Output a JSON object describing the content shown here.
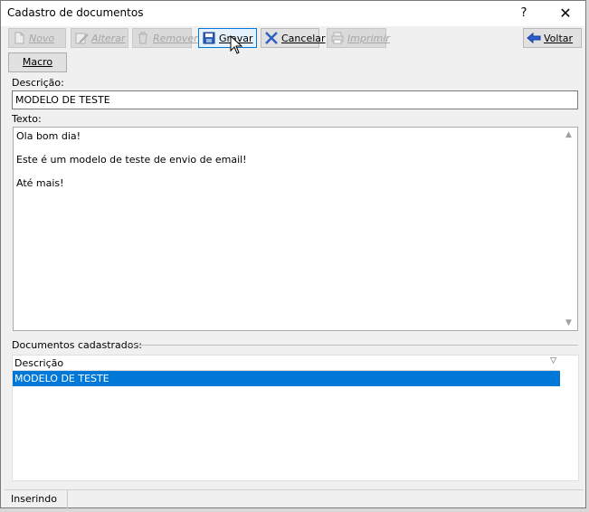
{
  "window": {
    "title": "Cadastro de documentos",
    "help_label": "?",
    "close_label": "✕"
  },
  "toolbar": {
    "novo": {
      "label": "Novo",
      "icon": "new-document-icon",
      "enabled": false
    },
    "alterar": {
      "label": "Alterar",
      "icon": "edit-icon",
      "enabled": false
    },
    "remover": {
      "label": "Remover",
      "icon": "trash-icon",
      "enabled": false
    },
    "gravar": {
      "label": "Gravar",
      "icon": "save-icon",
      "enabled": true
    },
    "cancelar": {
      "label": "Cancelar",
      "icon": "cancel-x-icon",
      "enabled": true
    },
    "imprimir": {
      "label": "Imprimir",
      "icon": "printer-icon",
      "enabled": false
    },
    "voltar": {
      "label": "Voltar",
      "icon": "back-arrow-icon",
      "enabled": true
    }
  },
  "macro": {
    "label": "Macro"
  },
  "form": {
    "descricao_label": "Descrição:",
    "descricao_value": "MODELO DE TESTE",
    "texto_label": "Texto:",
    "texto_lines": [
      "Ola bom dia!",
      "",
      "Este é um modelo de teste de envio de email!",
      "",
      "Até mais!"
    ]
  },
  "documentos": {
    "group_label": "Documentos cadastrados:",
    "column_header": "Descrição",
    "rows": [
      "MODELO DE TESTE"
    ],
    "selected_row_index": 0
  },
  "status": {
    "text": "Inserindo"
  },
  "colors": {
    "selection": "#0078d7",
    "accent_blue": "#1a5fb4",
    "cancel_red": "#3b6fd6"
  }
}
